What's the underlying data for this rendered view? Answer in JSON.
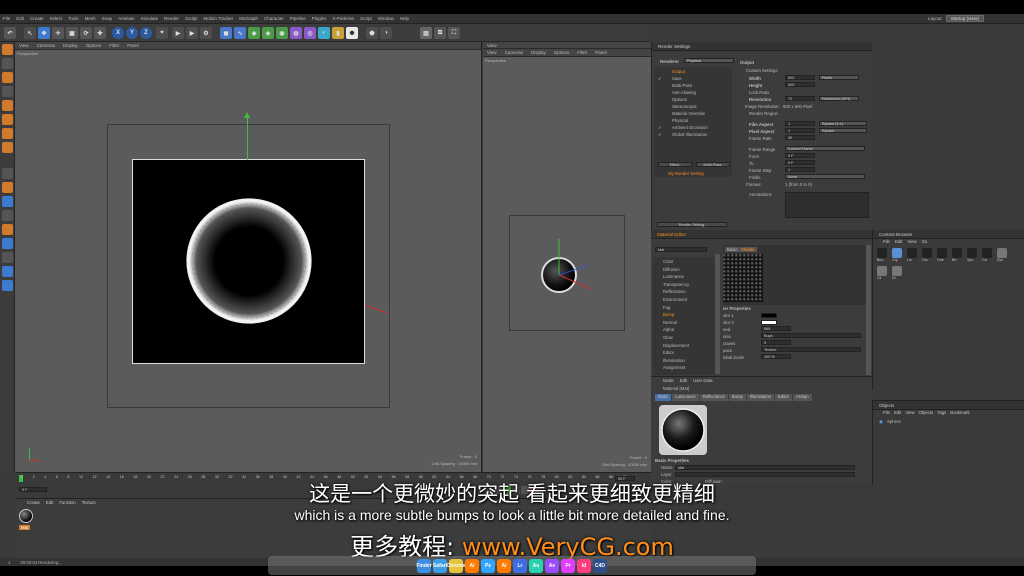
{
  "menu": [
    "File",
    "Edit",
    "Create",
    "Select",
    "Tools",
    "Mesh",
    "Snap",
    "Animate",
    "Simulate",
    "Render",
    "Sculpt",
    "Motion Tracker",
    "MoGraph",
    "Character",
    "Pipeline",
    "Plugins",
    "X-Particles",
    "Script",
    "Window",
    "Help"
  ],
  "layout": {
    "label": "Layout:",
    "value": "Startup (User)"
  },
  "left_viewport": {
    "menu": [
      "View",
      "Cameras",
      "Display",
      "Options",
      "Filter",
      "Panel"
    ],
    "name": "Perspective",
    "frame": "Frame : 0",
    "grid": "Grid Spacing : 10000 mm"
  },
  "right_viewport": {
    "title": "View",
    "menu": [
      "View",
      "Cameras",
      "Display",
      "Options",
      "Filter",
      "Panel"
    ],
    "name": "Perspective",
    "frame": "Frame : 0",
    "grid": "Grid Spacing : 10000 mm"
  },
  "render_settings": {
    "title": "Render Settings",
    "renderer_label": "Renderer",
    "renderer_value": "Physical",
    "items": [
      "Output",
      "Save",
      "Multi-Pass",
      "Anti-Aliasing",
      "Options",
      "Stereoscopic",
      "Material Override",
      "Physical",
      "Ambient Occlusion",
      "Global Illumination"
    ],
    "effect_btn": "Effect...",
    "multipass_btn": "Multi-Pass...",
    "setting_name": "My Render Setting",
    "render_btn": "Render Setting...",
    "output_title": "Output",
    "custom": "Custom Settings",
    "width_label": "Width",
    "width_value": "600",
    "width_unit": "Pixels",
    "height_label": "Height",
    "height_value": "600",
    "lock_label": "Lock Ratio",
    "res_label": "Resolution",
    "res_value": "72",
    "res_unit": "Pixels/Inch (DPI)",
    "imgres_label": "Image Resolution:",
    "imgres_value": "600 x 600 Pixel",
    "region_label": "Render Region",
    "film_label": "Film Aspect",
    "film_value": "1",
    "film_opt": "Square (1:1)",
    "pixel_label": "Pixel Aspect",
    "pixel_value": "1",
    "pixel_opt": "Square",
    "fps_label": "Frame Rate",
    "fps_value": "30",
    "range_label": "Frame Range",
    "range_value": "Current Frame",
    "from_label": "From",
    "from_value": "0 F",
    "to_label": "To",
    "to_value": "0 F",
    "step_label": "Frame Step",
    "step_value": "1",
    "fields_label": "Fields",
    "fields_value": "None",
    "frames_label": "Frames:",
    "frames_value": "1 (from 0 to 0)",
    "annot_label": "Annotations"
  },
  "material_editor": {
    "title": "Material Editor",
    "name": "Mat",
    "channels": [
      "Color",
      "Diffusion",
      "Luminance",
      "Transparency",
      "Reflectance",
      "Environment",
      "Fog",
      "Bump",
      "Normal",
      "Alpha",
      "Glow",
      "Displacement",
      "Editor",
      "Illumination",
      "Assignment"
    ],
    "tabs": [
      "Basic",
      "Shader"
    ],
    "props_title": "ier Properties",
    "props": [
      {
        "l": "olor 1",
        "v": ""
      },
      {
        "l": "olor 2",
        "v": ""
      },
      {
        "l": "eed",
        "v": "665"
      },
      {
        "l": "oise",
        "v": "Buya"
      },
      {
        "l": "ctaves",
        "v": "5"
      },
      {
        "l": "pace",
        "v": "Texture"
      },
      {
        "l": "lobal Scale",
        "v": "100 %"
      }
    ]
  },
  "content_browser": {
    "title": "Content Browser",
    "menu": [
      "File",
      "Edit",
      "View",
      "Go"
    ],
    "items": [
      "Boo",
      "Cry",
      "Lin",
      "Glo",
      "One",
      "Bri",
      "Spo",
      "Ca",
      "Eye",
      "Cli",
      "Dr"
    ]
  },
  "attributes": {
    "menu": [
      "Mode",
      "Edit",
      "User Data"
    ],
    "obj": "Material [Mat]",
    "tabs": [
      "Basic",
      "Luminance",
      "Reflectance",
      "Bump",
      "Illumination",
      "Editor",
      "Assign"
    ],
    "section": "Basic Properties",
    "name_label": "Name",
    "name_value": "Mat",
    "layer_label": "Layer",
    "color_label": "Color",
    "diff_label": "Diffusion"
  },
  "objects": {
    "title": "Objects",
    "menu": [
      "File",
      "Edit",
      "View",
      "Objects",
      "Tags",
      "Bookmark"
    ],
    "item": "Sphere"
  },
  "timeline": {
    "ticks": [
      "0",
      "2",
      "4",
      "6",
      "8",
      "10",
      "12",
      "14",
      "16",
      "18",
      "20",
      "22",
      "24",
      "26",
      "28",
      "30",
      "32",
      "34",
      "36",
      "38",
      "40",
      "42",
      "44",
      "46",
      "48",
      "50",
      "52",
      "54",
      "56",
      "58",
      "60",
      "62",
      "64",
      "66",
      "68",
      "70",
      "72",
      "74",
      "76",
      "78",
      "80",
      "82",
      "84",
      "86",
      "88",
      "90"
    ],
    "frame": "0 F",
    "end": "90 F"
  },
  "material_manager": {
    "menu": [
      "Create",
      "Edit",
      "Function",
      "Texture"
    ],
    "item": "Mat"
  },
  "status": {
    "time": "00:00:04 Rendering...",
    "val": "1"
  },
  "subtitles": {
    "cn": "这是一个更微妙的突起 看起来更细致更精细",
    "en": "which is a more subtle bumps to look a little bit more detailed and fine.",
    "brand_cn": "更多教程:",
    "brand_url": "www.VeryCG.com"
  },
  "dock": [
    "Finder",
    "Safari",
    "Chrome",
    "Ai",
    "Ps",
    "Ai",
    "Lr",
    "Au",
    "Ae",
    "Pr",
    "Id",
    "C4D"
  ]
}
